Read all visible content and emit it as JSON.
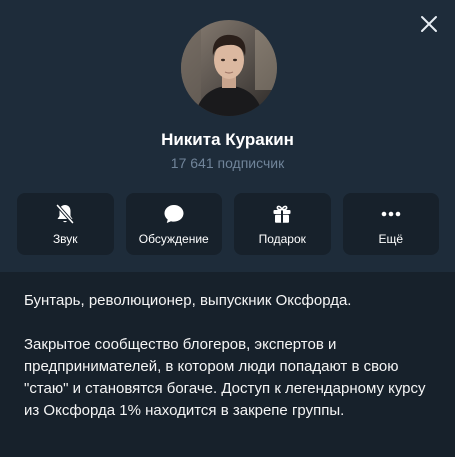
{
  "header": {
    "channel_name": "Никита Куракин",
    "subscribers": "17 641 подписчик"
  },
  "actions": [
    {
      "label": "Звук",
      "icon": "muted-bell-icon"
    },
    {
      "label": "Обсуждение",
      "icon": "chat-bubble-icon"
    },
    {
      "label": "Подарок",
      "icon": "gift-icon"
    },
    {
      "label": "Ещё",
      "icon": "more-dots-icon"
    }
  ],
  "description": {
    "line1": "Бунтарь, революционер, выпускник Оксфорда.",
    "paragraph2": "Закрытое сообщество блогеров, экспертов и предпринимателей, в котором люди попадают в свою \"стаю\" и становятся богаче. Доступ к легендарному курсу из Оксфорда 1% находится в закрепе группы."
  },
  "colors": {
    "background": "#17212b",
    "header_bg": "#1e2c3a",
    "muted_text": "#708499",
    "text": "#ffffff"
  }
}
